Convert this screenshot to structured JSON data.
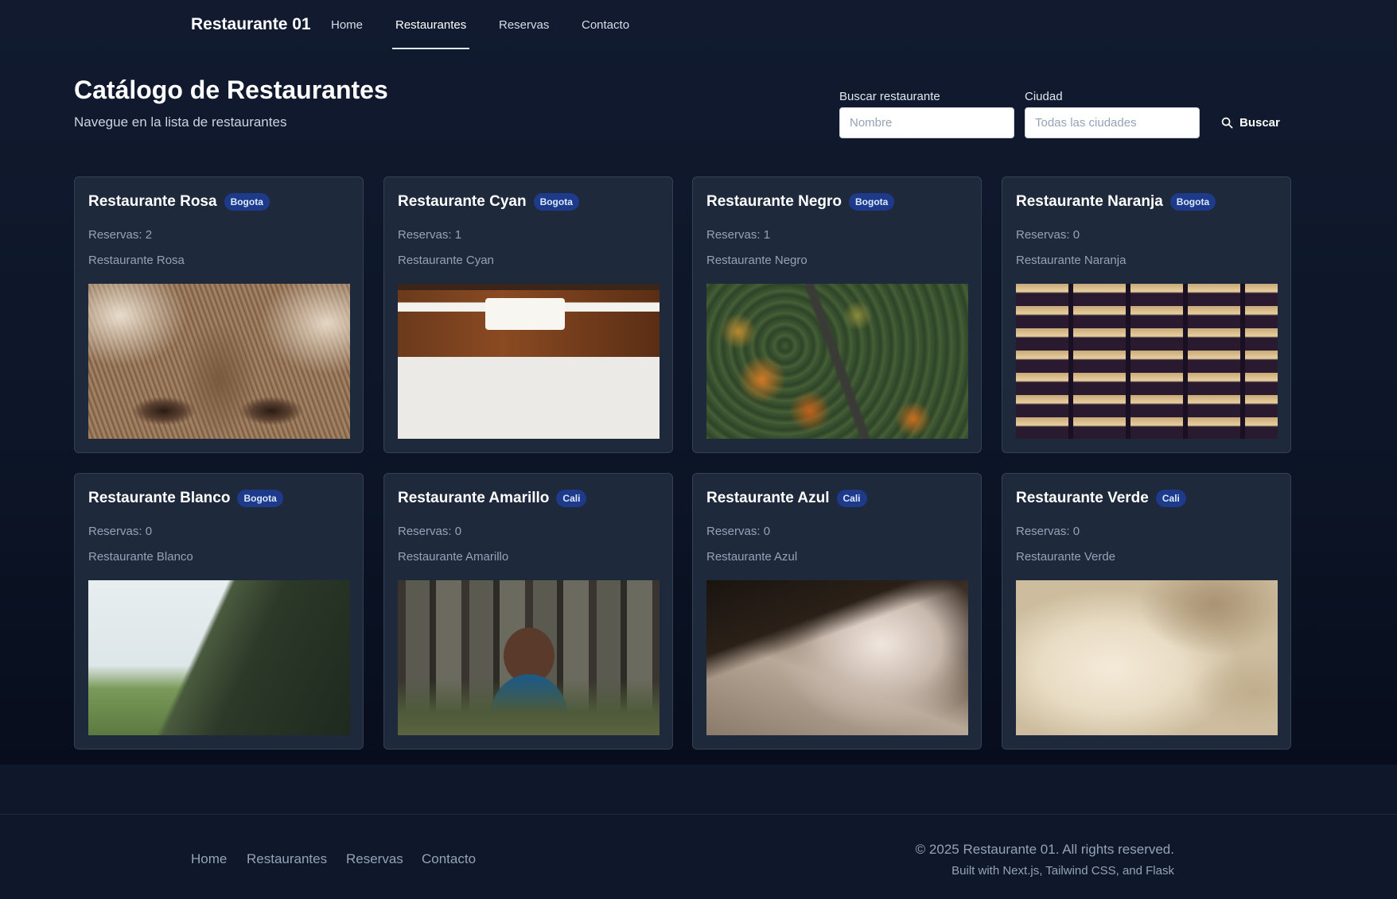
{
  "nav": {
    "brand": "Restaurante 01",
    "links": [
      "Home",
      "Restaurantes",
      "Reservas",
      "Contacto"
    ],
    "active": "Restaurantes"
  },
  "header": {
    "title": "Catálogo de Restaurantes",
    "subtitle": "Navegue en la lista de restaurantes"
  },
  "search": {
    "name_label": "Buscar restaurante",
    "name_placeholder": "Nombre",
    "city_label": "Ciudad",
    "city_placeholder": "Todas las ciudades",
    "button_label": "Buscar",
    "button_icon": "search-icon"
  },
  "restaurants": [
    {
      "name": "Restaurante Rosa",
      "city": "Bogota",
      "reservas": "Reservas: 2",
      "description": "Restaurante Rosa",
      "image": "wolf-closeup"
    },
    {
      "name": "Restaurante Cyan",
      "city": "Bogota",
      "reservas": "Reservas: 1",
      "description": "Restaurante Cyan",
      "image": "desk-top-view"
    },
    {
      "name": "Restaurante Negro",
      "city": "Bogota",
      "reservas": "Reservas: 1",
      "description": "Restaurante Negro",
      "image": "forest-aerial"
    },
    {
      "name": "Restaurante Naranja",
      "city": "Bogota",
      "reservas": "Reservas: 0",
      "description": "Restaurante Naranja",
      "image": "building-windows-night"
    },
    {
      "name": "Restaurante Blanco",
      "city": "Bogota",
      "reservas": "Reservas: 0",
      "description": "Restaurante Blanco",
      "image": "cliff-landscape"
    },
    {
      "name": "Restaurante Amarillo",
      "city": "Cali",
      "reservas": "Reservas: 0",
      "description": "Restaurante Amarillo",
      "image": "person-in-forest"
    },
    {
      "name": "Restaurante Azul",
      "city": "Cali",
      "reservas": "Reservas: 0",
      "description": "Restaurante Azul",
      "image": "waterfall-mist"
    },
    {
      "name": "Restaurante Verde",
      "city": "Cali",
      "reservas": "Reservas: 0",
      "description": "Restaurante Verde",
      "image": "cloudy-sky"
    }
  ],
  "footer": {
    "links": [
      "Home",
      "Restaurantes",
      "Reservas",
      "Contacto"
    ],
    "copyright": "© 2025 Restaurante 01. All rights reserved.",
    "built_with": "Built with Next.js, Tailwind CSS, and Flask"
  },
  "colors": {
    "background": "#0f172a",
    "card": "#1e293b",
    "badge": "#1e3a8a"
  }
}
